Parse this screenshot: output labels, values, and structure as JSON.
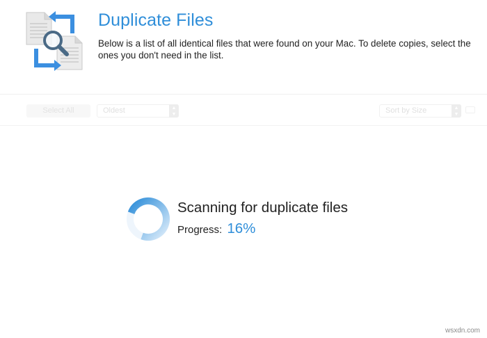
{
  "header": {
    "title": "Duplicate Files",
    "description": "Below is a list of all identical files that were found on your Mac. To delete copies, select the ones you don't need in the list.",
    "icon": "duplicate-files-icon"
  },
  "toolbar": {
    "select_all_label": "Select All",
    "selection_rule": "Oldest",
    "sort_label": "Sort by Size"
  },
  "scan": {
    "title": "Scanning for duplicate files",
    "progress_label": "Progress:",
    "progress_value": "16%",
    "progress_fraction": 0.16
  },
  "watermark": "wsxdn.com",
  "colors": {
    "accent": "#2f8ed9",
    "text": "#222222"
  }
}
